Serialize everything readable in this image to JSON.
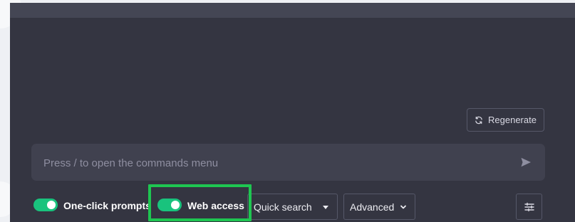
{
  "regenerate": {
    "label": "Regenerate",
    "icon": "refresh-icon"
  },
  "composer": {
    "placeholder": "Press / to open the commands menu",
    "value": "",
    "send_icon": "send-icon"
  },
  "toggles": [
    {
      "label": "One-click prompts",
      "on": true
    },
    {
      "label": "Web access",
      "on": true
    }
  ],
  "search_mode": {
    "selected": "Quick search",
    "icon": "caret-down-icon"
  },
  "region_mode": {
    "selected": "Advanced",
    "icon": "chevron-down-icon"
  },
  "settings": {
    "icon": "sliders-icon"
  },
  "colors": {
    "panel_bg": "#343541",
    "input_bg": "#40414f",
    "toggle_on": "#19c37d",
    "highlight": "#1ec651"
  }
}
